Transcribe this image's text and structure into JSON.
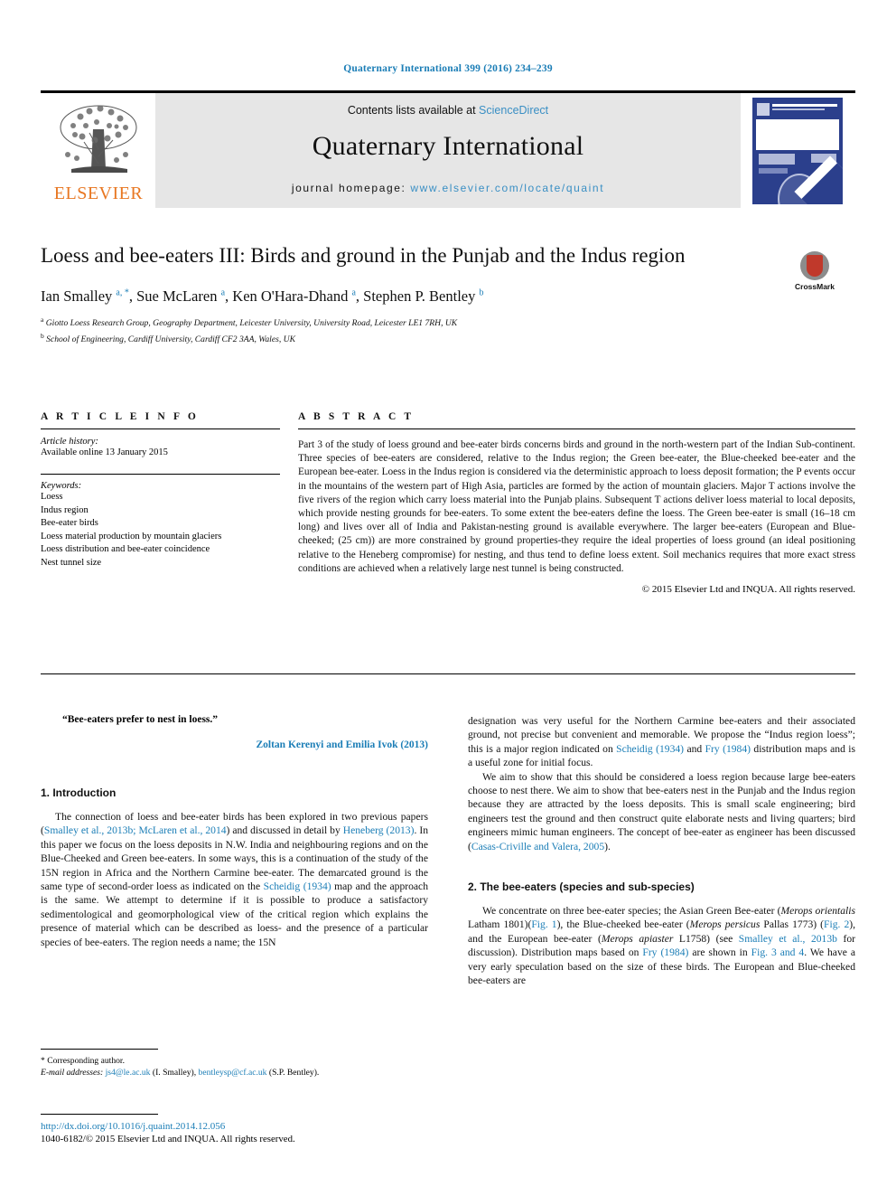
{
  "running_head": "Quaternary International 399 (2016) 234–239",
  "masthead": {
    "contents_prefix": "Contents lists available at ",
    "sciencedirect": "ScienceDirect",
    "journal_name": "Quaternary International",
    "homepage_prefix": "journal homepage: ",
    "homepage_url": "www.elsevier.com/locate/quaint",
    "publisher": "ELSEVIER",
    "accent_link_color": "#3a8fc4",
    "publisher_color": "#e87722",
    "cover_color": "#2b3f8c"
  },
  "article": {
    "title": "Loess and bee-eaters III: Birds and ground in the Punjab and the Indus region",
    "crossmark_label": "CrossMark",
    "authors_html": "Ian Smalley <sup>a, *</sup>, Sue McLaren <sup>a</sup>, Ken O'Hara-Dhand <sup>a</sup>, Stephen P. Bentley <sup>b</sup>",
    "affiliation_a": "Giotto Loess Research Group, Geography Department, Leicester University, University Road, Leicester LE1 7RH, UK",
    "affiliation_b": "School of Engineering, Cardiff University, Cardiff CF2 3AA, Wales, UK"
  },
  "info": {
    "heading": "A R T I C L E   I N F O",
    "history_title": "Article history:",
    "history_line": "Available online 13 January 2015",
    "keywords_title": "Keywords:",
    "keywords": [
      "Loess",
      "Indus region",
      "Bee-eater birds",
      "Loess material production by mountain glaciers",
      "Loess distribution and bee-eater coincidence",
      "Nest tunnel size"
    ]
  },
  "abstract": {
    "heading": "A B S T R A C T",
    "text": "Part 3 of the study of loess ground and bee-eater birds concerns birds and ground in the north-western part of the Indian Sub-continent. Three species of bee-eaters are considered, relative to the Indus region; the Green bee-eater, the Blue-cheeked bee-eater and the European bee-eater. Loess in the Indus region is considered via the deterministic approach to loess deposit formation; the P events occur in the mountains of the western part of High Asia, particles are formed by the action of mountain glaciers. Major T actions involve the five rivers of the region which carry loess material into the Punjab plains. Subsequent T actions deliver loess material to local deposits, which provide nesting grounds for bee-eaters. To some extent the bee-eaters define the loess. The Green bee-eater is small (16–18 cm long) and lives over all of India and Pakistan-nesting ground is available everywhere. The larger bee-eaters (European and Blue-cheeked; (25 cm)) are more constrained by ground properties-they require the ideal properties of loess ground (an ideal positioning relative to the Heneberg compromise) for nesting, and thus tend to define loess extent. Soil mechanics requires that more exact stress conditions are achieved when a relatively large nest tunnel is being constructed.",
    "copyright": "© 2015 Elsevier Ltd and INQUA. All rights reserved."
  },
  "body": {
    "epigraph": "“Bee-eaters prefer to nest in loess.”",
    "epigraph_attribution": "Zoltan Kerenyi and Emilia Ivok (2013)",
    "section1_heading": "1.  Introduction",
    "section2_heading": "2.  The bee-eaters (species and sub-species)",
    "left_para1_html": "The connection of loess and bee-eater birds has been explored in two previous papers (<a class=\"ref\" href=\"#\">Smalley et al., 2013b; McLaren et al., 2014</a>) and discussed in detail by <a class=\"ref\" href=\"#\">Heneberg (2013)</a>. In this paper we focus on the loess deposits in N.W. India and neighbouring regions and on the Blue-Cheeked and Green bee-eaters. In some ways, this is a continuation of the study of the 15N region in Africa and the Northern Carmine bee-eater. The demarcated ground is the same type of second-order loess as indicated on the <a class=\"ref\" href=\"#\">Scheidig (1934)</a> map and the approach is the same. We attempt to determine if it is possible to produce a satisfactory sedimentological and geomorphological view of the critical region which explains the presence of material which can be described as loess- and the presence of a particular species of bee-eaters. The region needs a name; the 15N",
    "right_para1_html": "designation was very useful for the Northern Carmine bee-eaters and their associated ground, not precise but convenient and memorable. We propose the “Indus region loess”; this is a major region indicated on <a class=\"ref\" href=\"#\">Scheidig (1934)</a> and <a class=\"ref\" href=\"#\">Fry (1984)</a> distribution maps and is a useful zone for initial focus.",
    "right_para2_html": "We aim to show that this should be considered a loess region because large bee-eaters choose to nest there. We aim to show that bee-eaters nest in the Punjab and the Indus region because they are attracted by the loess deposits. This is small scale engineering; bird engineers test the ground and then construct quite elaborate nests and living quarters; bird engineers mimic human engineers. The concept of bee-eater as engineer has been discussed (<a class=\"ref\" href=\"#\">Casas-Criville and Valera, 2005</a>).",
    "right_para3_html": "We concentrate on three bee-eater species; the Asian Green Bee-eater (<span class=\"ital\">Merops orientalis</span> Latham 1801)(<a class=\"ref\" href=\"#\">Fig. 1</a>), the Blue-cheeked bee-eater (<span class=\"ital\">Merops persicus</span> Pallas 1773) (<a class=\"ref\" href=\"#\">Fig. 2</a>), and the European bee-eater (<span class=\"ital\">Merops apiaster</span> L1758) (see <a class=\"ref\" href=\"#\">Smalley et al., 2013b</a> for discussion). Distribution maps based on <a class=\"ref\" href=\"#\">Fry (1984)</a> are shown in <a class=\"ref\" href=\"#\">Fig. 3 and 4</a>. We have a very early speculation based on the size of these birds. The European and Blue-cheeked bee-eaters are"
  },
  "footer": {
    "corresponding_label": "* Corresponding author.",
    "email_html": "<span class=\"fn-em\">E-mail addresses:</span> <a class=\"ref\" href=\"#\">js4@le.ac.uk</a> (I. Smalley), <a class=\"ref\" href=\"#\">bentleysp@cf.ac.uk</a> (S.P. Bentley).",
    "doi_url": "http://dx.doi.org/10.1016/j.quaint.2014.12.056",
    "copyright_line": "1040-6182/© 2015 Elsevier Ltd and INQUA. All rights reserved."
  }
}
